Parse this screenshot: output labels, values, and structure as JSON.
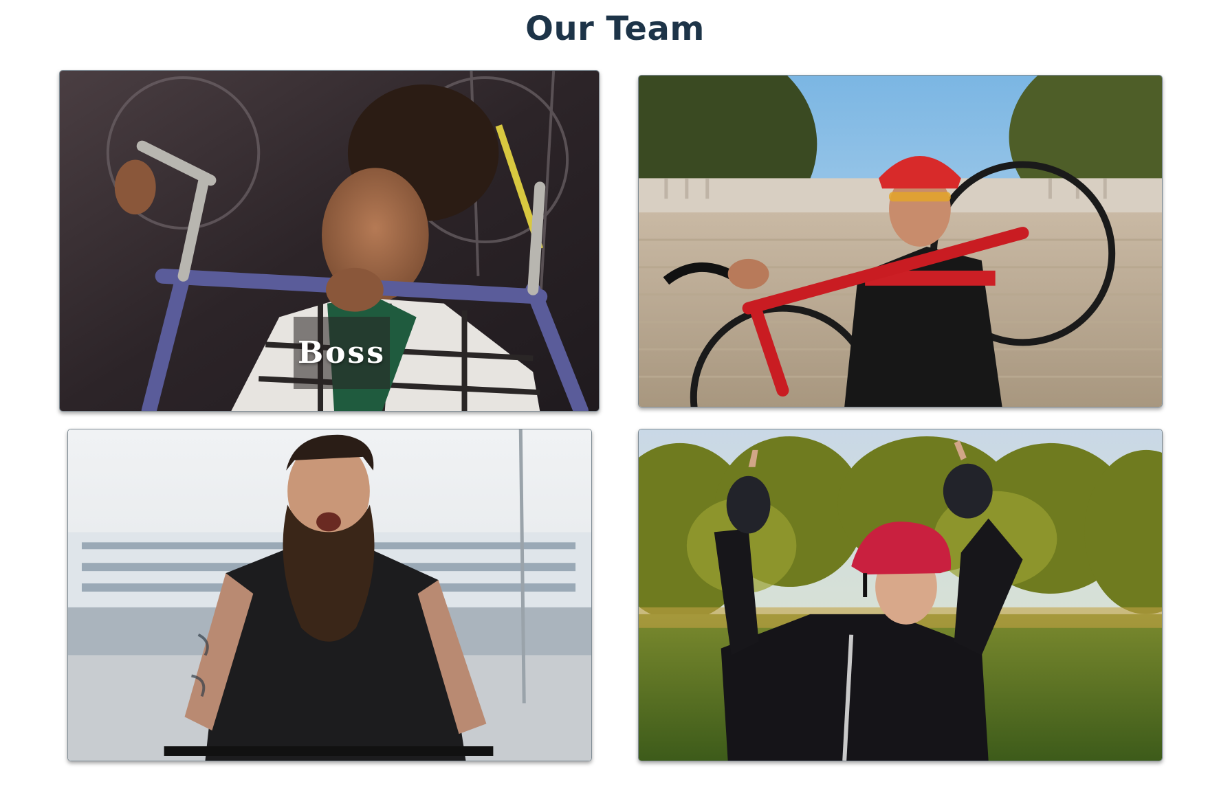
{
  "page": {
    "title": "Our Team"
  },
  "team": [
    {
      "role": "Boss",
      "photo": "woman-holding-bike-frame-in-workshop"
    },
    {
      "role": "",
      "photo": "man-carrying-red-road-bike-on-stairs"
    },
    {
      "role": "",
      "photo": "bearded-man-riding-bike-by-ship"
    },
    {
      "role": "",
      "photo": "woman-in-helmet-waving-in-park"
    }
  ],
  "colors": {
    "title": "#1d3448",
    "card_border": "#7d8a93",
    "label_overlay": "rgba(40,35,35,0.55)"
  }
}
